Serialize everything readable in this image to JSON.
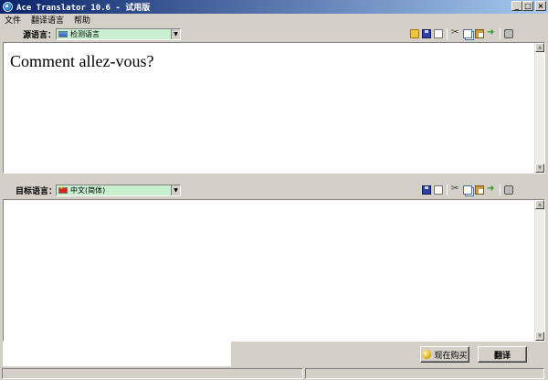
{
  "window": {
    "title": "Ace Translator 10.6 - 试用版",
    "controls": [
      "_",
      "□",
      "×"
    ]
  },
  "menu": [
    "文件",
    "翻译语言",
    "帮助"
  ],
  "source": {
    "label": "源语言：",
    "language": "检测语言",
    "text": "Comment allez-vous?"
  },
  "target": {
    "label": "目标语言：",
    "language": "中文(简体)",
    "text": ""
  },
  "footer": {
    "buy_label": "现在购买",
    "translate_label": "翻译"
  },
  "icons": {
    "source_toolbar": [
      "folder-open-icon",
      "save-icon",
      "new-document-icon",
      "cut-icon",
      "copy-icon",
      "paste-icon",
      "swap-icon",
      "print-icon"
    ],
    "target_toolbar": [
      "save-icon",
      "new-document-icon",
      "cut-icon",
      "copy-icon",
      "paste-icon",
      "swap-icon",
      "print-icon"
    ]
  }
}
